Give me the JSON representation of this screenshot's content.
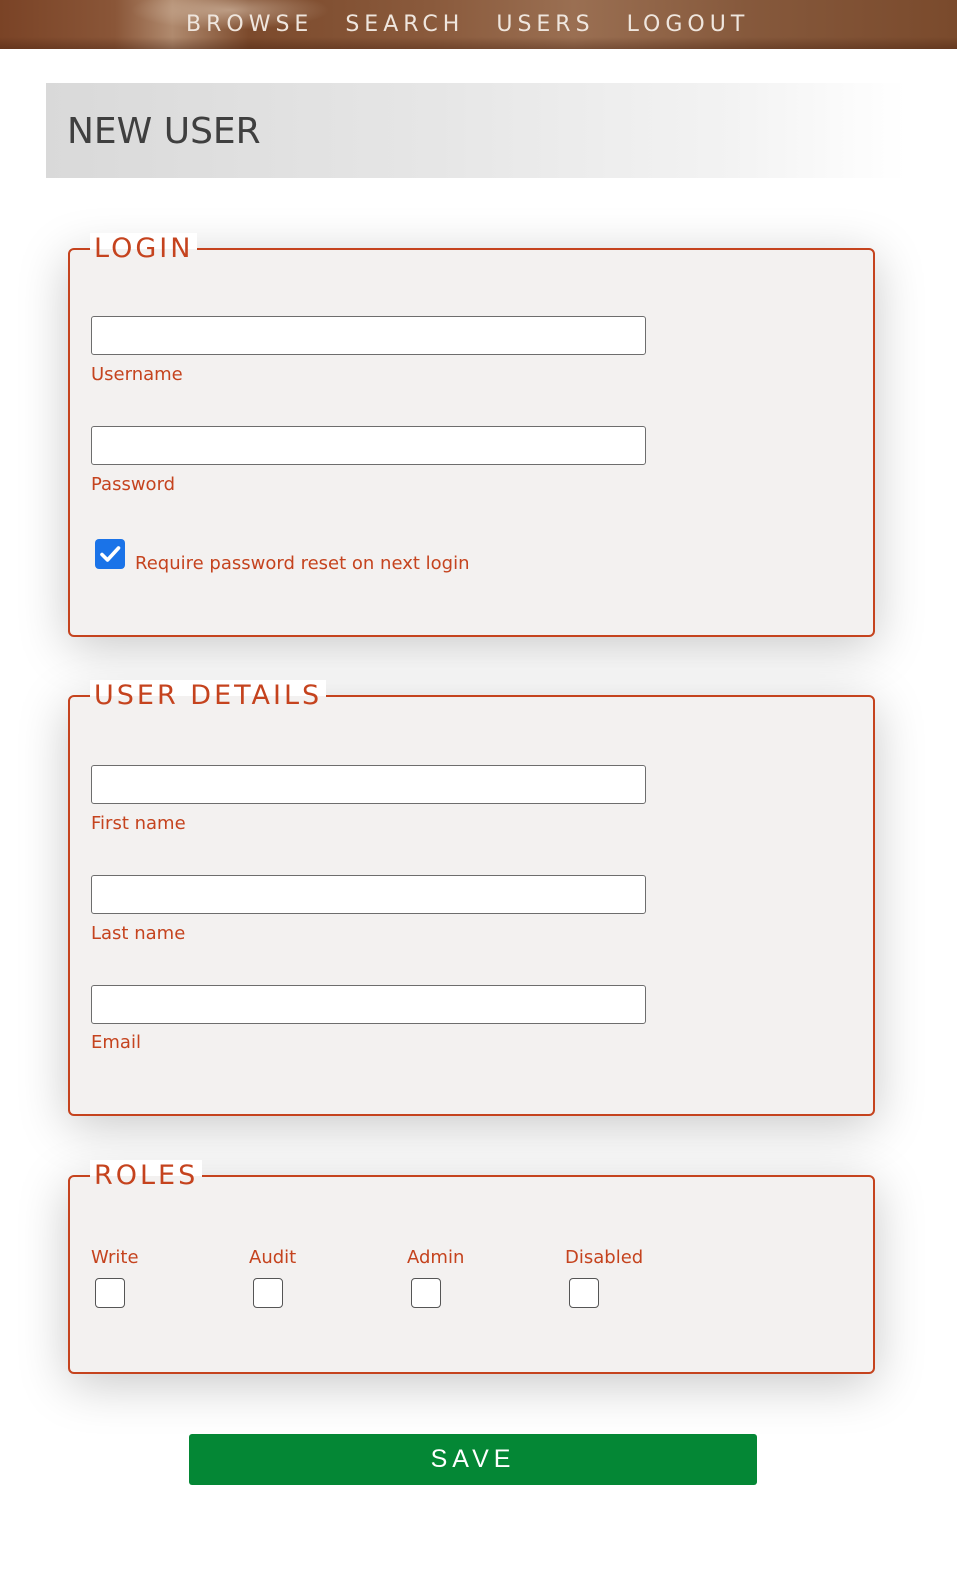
{
  "nav": {
    "items": [
      {
        "label": "BROWSE"
      },
      {
        "label": "SEARCH"
      },
      {
        "label": "USERS"
      },
      {
        "label": "LOGOUT"
      }
    ]
  },
  "header": {
    "title": "NEW USER"
  },
  "login": {
    "legend": "LOGIN",
    "username": {
      "label": "Username",
      "value": ""
    },
    "password": {
      "label": "Password",
      "value": ""
    },
    "reset": {
      "label": "Require password reset on next login",
      "checked": true
    }
  },
  "details": {
    "legend": "USER DETAILS",
    "first_name": {
      "label": "First name",
      "value": ""
    },
    "last_name": {
      "label": "Last name",
      "value": ""
    },
    "email": {
      "label": "Email",
      "value": ""
    }
  },
  "roles": {
    "legend": "ROLES",
    "items": [
      {
        "label": "Write",
        "checked": false
      },
      {
        "label": "Audit",
        "checked": false
      },
      {
        "label": "Admin",
        "checked": false
      },
      {
        "label": "Disabled",
        "checked": false
      }
    ]
  },
  "actions": {
    "save_label": "SAVE"
  },
  "colors": {
    "accent": "#c5431e",
    "save": "#048735",
    "checkbox": "#1a73e8"
  }
}
